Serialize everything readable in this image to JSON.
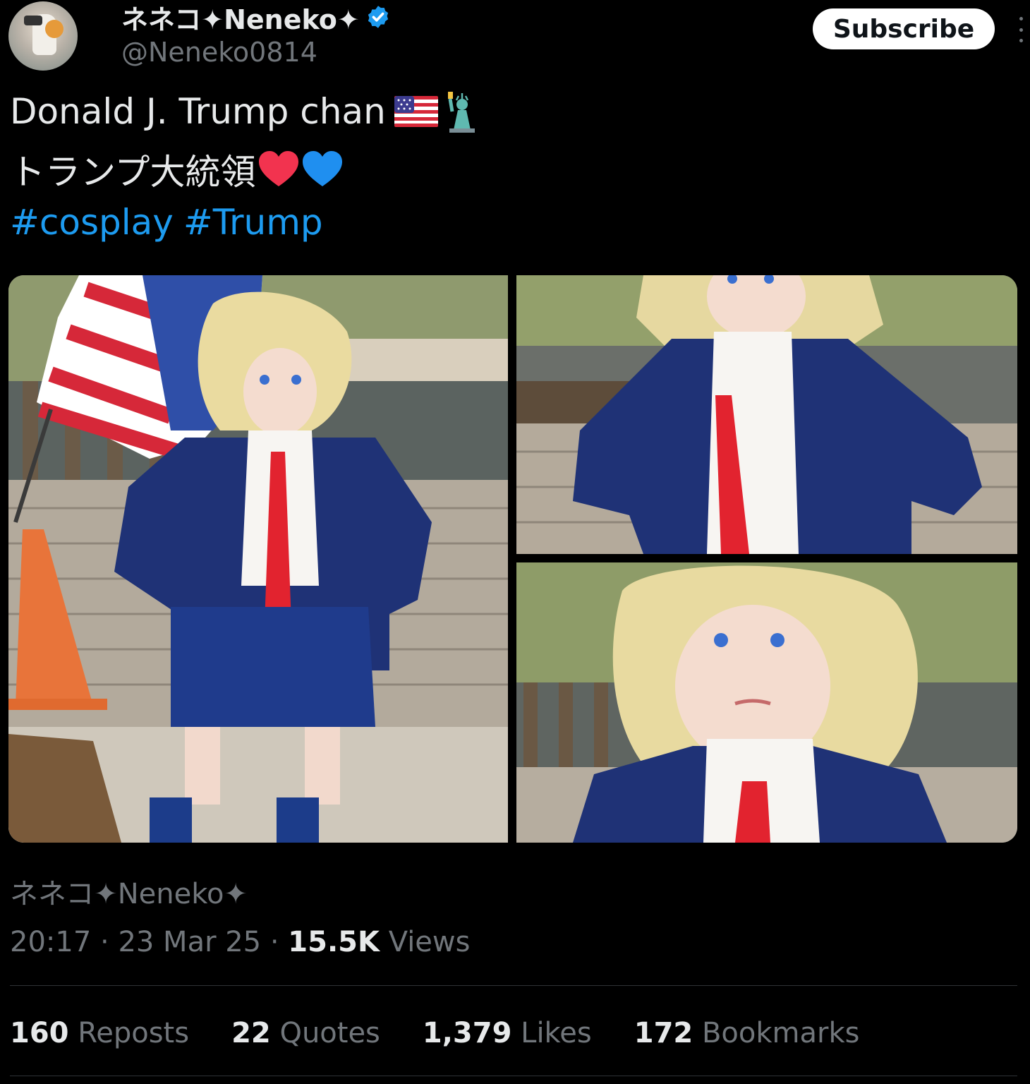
{
  "author": {
    "display_name": "ネネコ✦Neneko✦",
    "handle": "@Neneko0814",
    "verified": true,
    "avatar_icon": "avatar-image"
  },
  "actions": {
    "subscribe_label": "Subscribe",
    "more_icon": "more-vertical-icon"
  },
  "tweet": {
    "line1_text": "Donald J. Trump chan",
    "line1_emojis": [
      "us-flag-emoji",
      "statue-of-liberty-emoji"
    ],
    "line2_text": "トランプ大統領",
    "line2_emojis": [
      "red-heart-emoji",
      "blue-heart-emoji"
    ],
    "hashtags": [
      "#cosplay",
      "#Trump"
    ]
  },
  "media": {
    "photos": [
      "cosplay-photo-full-body",
      "cosplay-photo-upper-body",
      "cosplay-photo-closeup"
    ]
  },
  "footer": {
    "author_repeat": "ネネコ✦Neneko✦",
    "time": "20:17",
    "date": "23 Mar 25",
    "views_count": "15.5K",
    "views_label": "Views",
    "separator": "·"
  },
  "stats": [
    {
      "count": "160",
      "label": "Reposts"
    },
    {
      "count": "22",
      "label": "Quotes"
    },
    {
      "count": "1,379",
      "label": "Likes"
    },
    {
      "count": "172",
      "label": "Bookmarks"
    }
  ],
  "colors": {
    "background": "#000000",
    "text_primary": "#e7e9ea",
    "text_secondary": "#71767b",
    "accent_blue": "#1d9bf0",
    "divider": "#2f3336"
  }
}
